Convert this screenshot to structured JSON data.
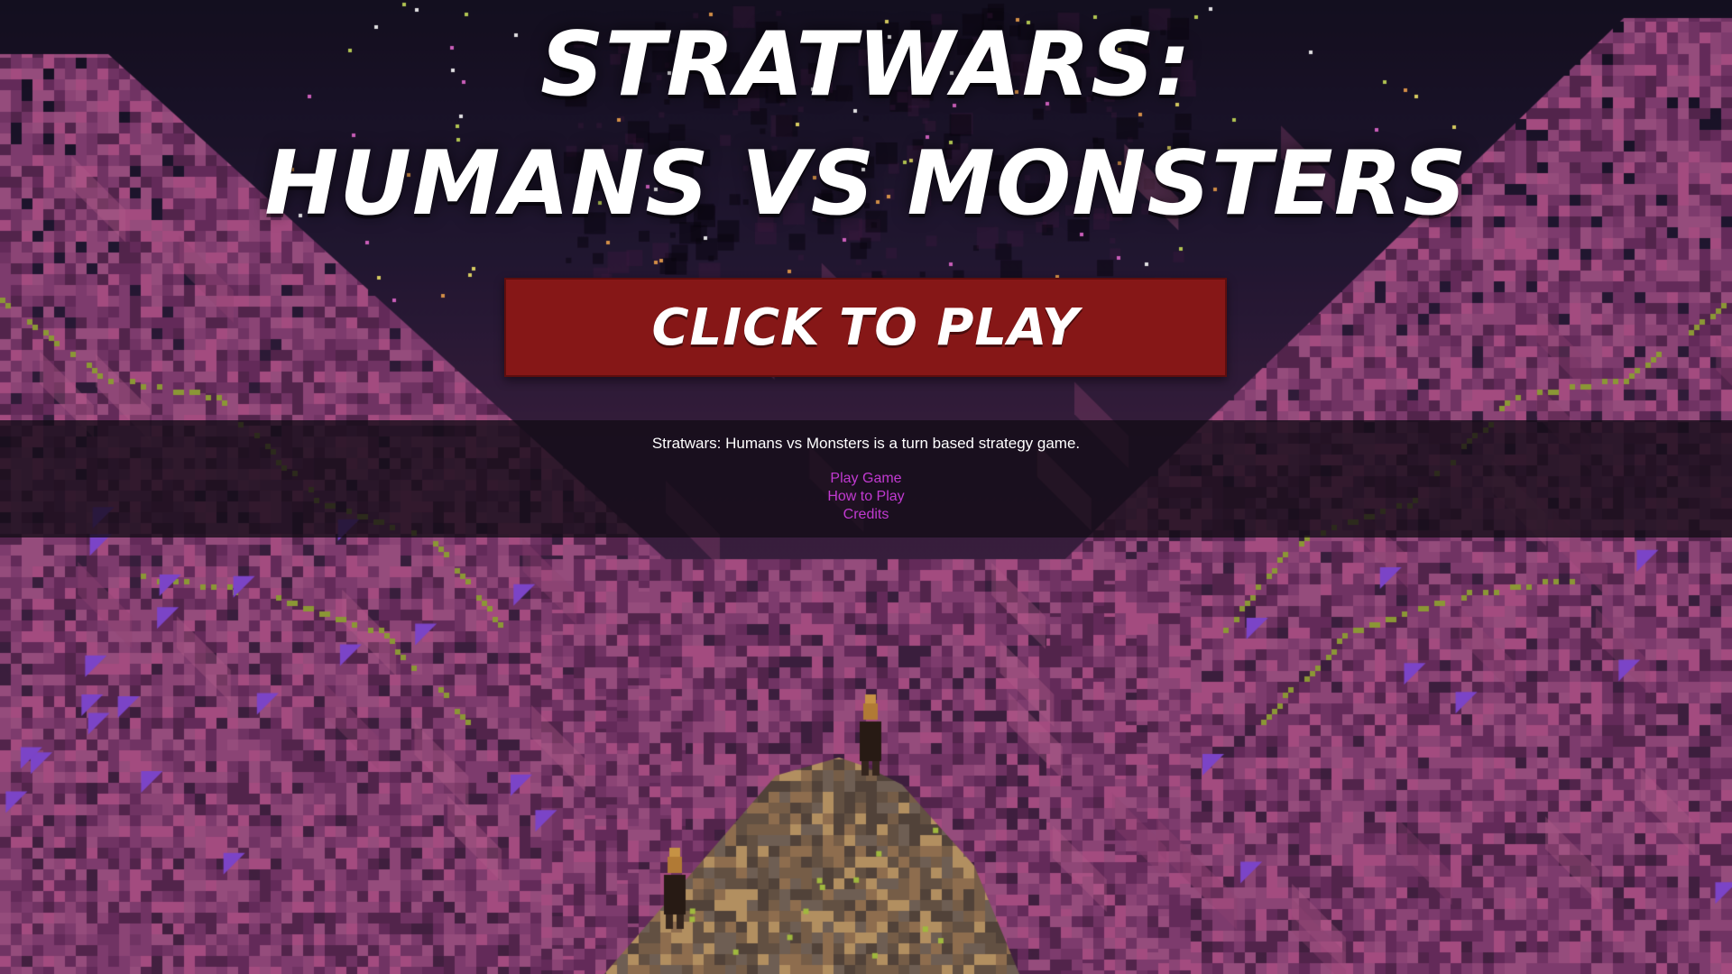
{
  "title": {
    "line1": "STRATWARS:",
    "line2": "HUMANS VS MONSTERS"
  },
  "play_button": {
    "label": "CLICK TO PLAY",
    "color": "#861717"
  },
  "info": {
    "description": "Stratwars: Humans vs Monsters is a turn based strategy game.",
    "links": [
      {
        "label": "Play Game"
      },
      {
        "label": "How to Play"
      },
      {
        "label": "Credits"
      }
    ],
    "link_color": "#c13ad1"
  },
  "background": {
    "scene": "pixel-art mountain at night with two figures",
    "palette": {
      "sky": "#1b1428",
      "terrain": "#7e3a6e",
      "terrain_light": "#b8558e",
      "highlight": "#9cab3a",
      "rock": "#6e5a48",
      "rock_light": "#c9a26a"
    }
  }
}
